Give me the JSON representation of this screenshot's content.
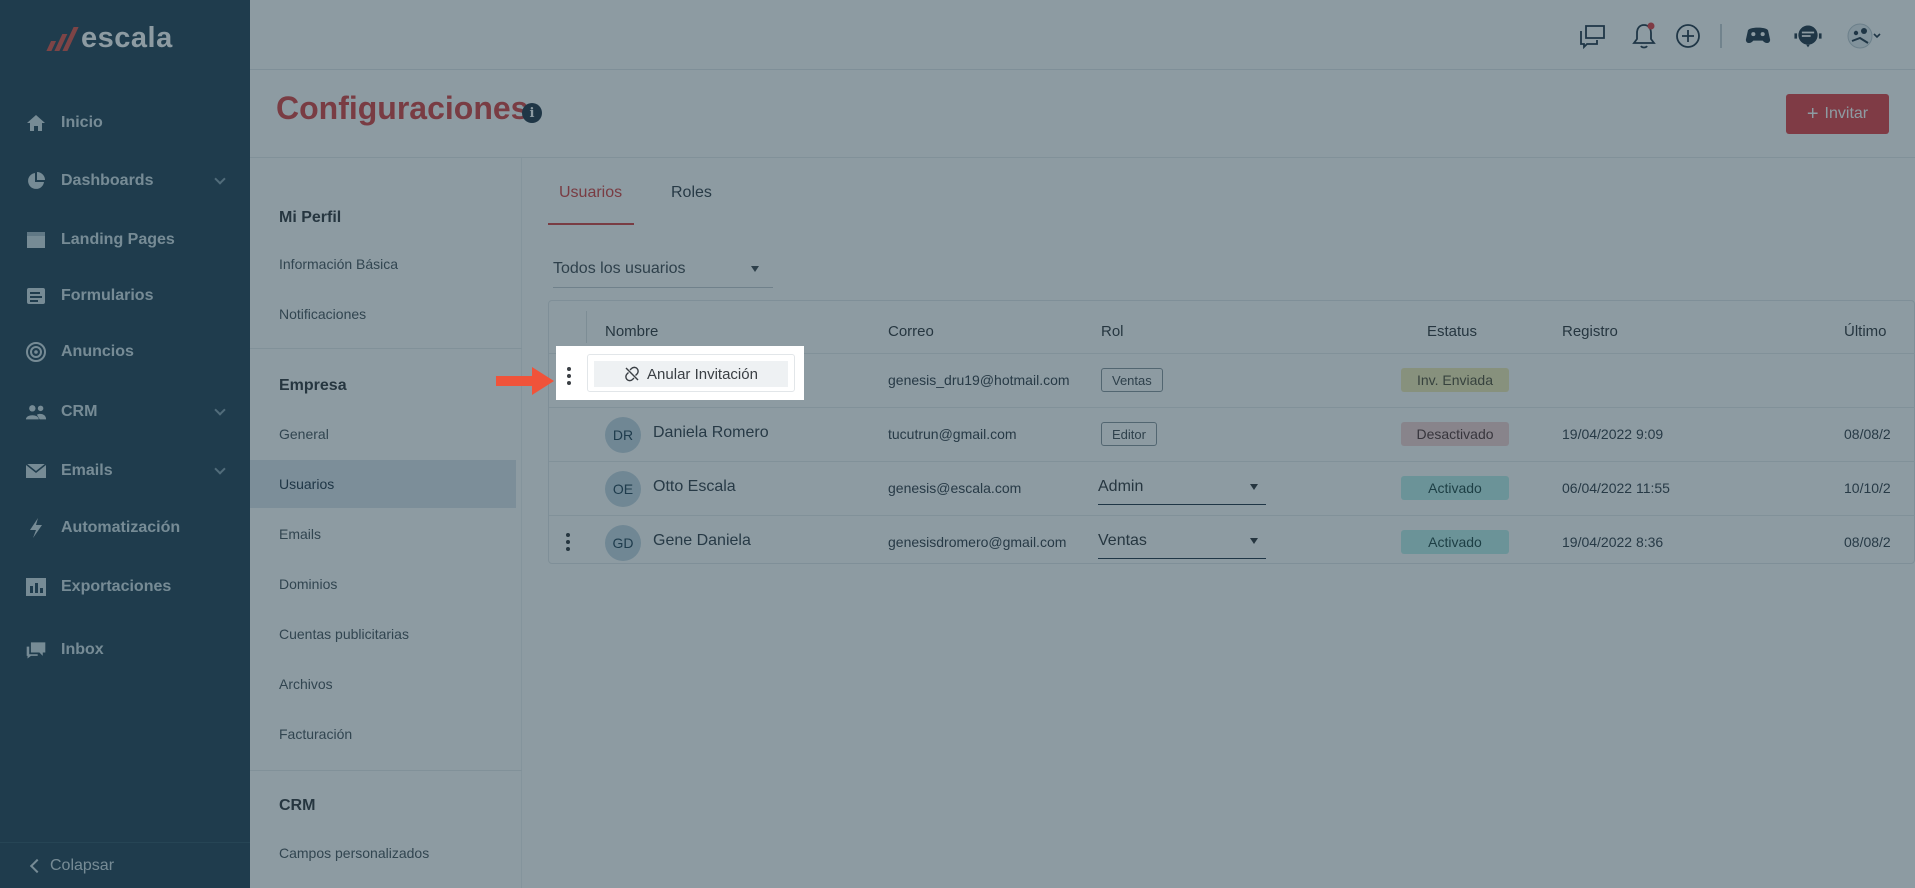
{
  "app": {
    "name": "escala"
  },
  "sidebar": {
    "items": [
      {
        "label": "Inicio",
        "icon": "home-icon"
      },
      {
        "label": "Dashboards",
        "icon": "pie-chart-icon"
      },
      {
        "label": "Landing Pages",
        "icon": "browser-window-icon"
      },
      {
        "label": "Formularios",
        "icon": "form-icon"
      },
      {
        "label": "Anuncios",
        "icon": "target-icon"
      },
      {
        "label": "CRM",
        "icon": "users-icon"
      },
      {
        "label": "Emails",
        "icon": "envelope-icon"
      },
      {
        "label": "Automatización",
        "icon": "lightning-icon"
      },
      {
        "label": "Exportaciones",
        "icon": "export-chart-icon"
      },
      {
        "label": "Inbox",
        "icon": "chat-bubbles-icon"
      }
    ],
    "collapse_label": "Colapsar"
  },
  "header": {
    "title": "Configuraciones",
    "invite_label": "Invitar"
  },
  "settings_nav": {
    "sections": [
      {
        "title": "Mi Perfil",
        "items": [
          "Información Básica",
          "Notificaciones"
        ]
      },
      {
        "title": "Empresa",
        "items": [
          "General",
          "Usuarios",
          "Emails",
          "Dominios",
          "Cuentas publicitarias",
          "Archivos",
          "Facturación"
        ]
      },
      {
        "title": "CRM",
        "items": [
          "Campos personalizados"
        ]
      }
    ],
    "active": "Usuarios"
  },
  "tabs": [
    "Usuarios",
    "Roles"
  ],
  "filter": {
    "value": "Todos los usuarios"
  },
  "table": {
    "columns": [
      "Nombre",
      "Correo",
      "Rol",
      "Estatus",
      "Registro",
      "Último"
    ],
    "rows": [
      {
        "initials": "",
        "name": "",
        "email": "genesis_dru19@hotmail.com",
        "role": "Ventas",
        "status": "Inv. Enviada",
        "registered": "",
        "last": ""
      },
      {
        "initials": "DR",
        "name": "Daniela Romero",
        "email": "tucutrun@gmail.com",
        "role": "Editor",
        "status": "Desactivado",
        "registered": "19/04/2022 9:09",
        "last": "08/08/2"
      },
      {
        "initials": "OE",
        "name": "Otto Escala",
        "email": "genesis@escala.com",
        "role": "Admin",
        "status": "Activado",
        "registered": "06/04/2022 11:55",
        "last": "10/10/2"
      },
      {
        "initials": "GD",
        "name": "Gene Daniela",
        "email": "genesisdromero@gmail.com",
        "role": "Ventas",
        "status": "Activado",
        "registered": "19/04/2022 8:36",
        "last": "08/08/2"
      }
    ]
  },
  "popup": {
    "action_label": "Anular Invitación"
  },
  "colors": {
    "accent": "#d94a4a",
    "sidebar": "#2c4a5c",
    "arrow": "#f0533a"
  }
}
